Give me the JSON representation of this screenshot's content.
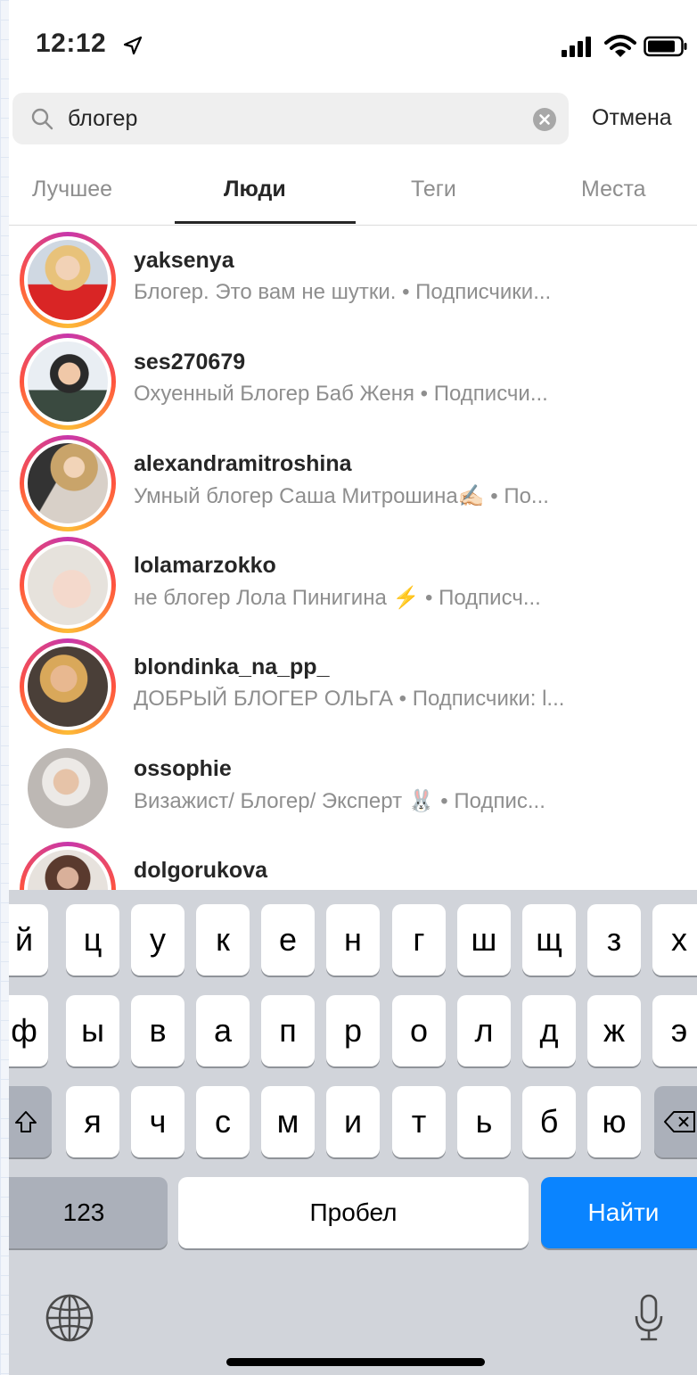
{
  "status_bar": {
    "time": "12:12"
  },
  "search": {
    "query": "блогер",
    "cancel_label": "Отмена"
  },
  "tabs": [
    {
      "label": "Лучшее",
      "active": false
    },
    {
      "label": "Люди",
      "active": true
    },
    {
      "label": "Теги",
      "active": false
    },
    {
      "label": "Места",
      "active": false
    }
  ],
  "results": [
    {
      "username": "yaksenya",
      "subtitle": "Блогер. Это вам не шутки. • Подписчики..."
    },
    {
      "username": "ses270679",
      "subtitle": "Охуенный Блогер Баб Женя • Подписчи..."
    },
    {
      "username": "alexandramitroshina",
      "subtitle": "Умный блогер Саша Митрошина✍🏻 • По..."
    },
    {
      "username": "lolamarzokko",
      "subtitle": "не блогер Лола Пинигина ⚡ • Подписч..."
    },
    {
      "username": "blondinka_na_pp_",
      "subtitle": "ДОБРЫЙ БЛОГЕР ОЛЬГА • Подписчики: l..."
    },
    {
      "username": "ossophie",
      "subtitle": "Визажист/ Блогер/ Эксперт 🐰 • Подпис..."
    },
    {
      "username": "dolgorukova",
      "subtitle": ""
    }
  ],
  "keyboard": {
    "row1": [
      "й",
      "ц",
      "у",
      "к",
      "е",
      "н",
      "г",
      "ш",
      "щ",
      "з",
      "х"
    ],
    "row2": [
      "ф",
      "ы",
      "в",
      "а",
      "п",
      "р",
      "о",
      "л",
      "д",
      "ж",
      "э"
    ],
    "row3": [
      "я",
      "ч",
      "с",
      "м",
      "и",
      "т",
      "ь",
      "б",
      "ю"
    ],
    "numbers_label": "123",
    "space_label": "Пробел",
    "go_label": "Найти"
  },
  "colors": {
    "accent_blue": "#0a84ff",
    "story_ring": "#c837ab",
    "text_primary": "#262626",
    "text_secondary": "#8e8e8e"
  }
}
